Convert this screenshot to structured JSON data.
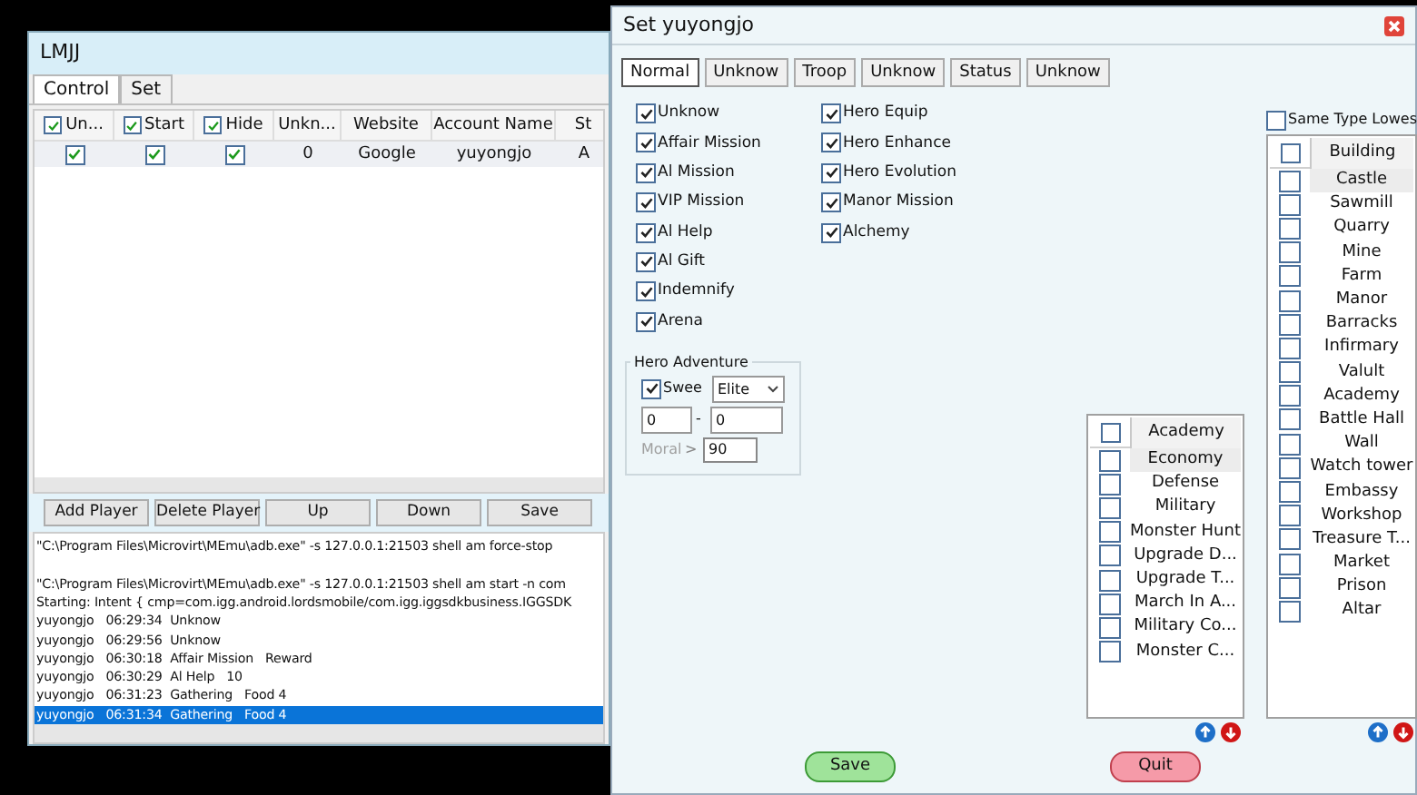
{
  "main_window": {
    "title": "LMJJ",
    "tabs": [
      {
        "label": "Control",
        "selected": true
      },
      {
        "label": "Set",
        "selected": false
      }
    ],
    "table": {
      "columns": [
        {
          "label": "Un...",
          "kind": "check",
          "checked": true
        },
        {
          "label": "Start",
          "kind": "check",
          "checked": true
        },
        {
          "label": "Hide",
          "kind": "check",
          "checked": true
        },
        {
          "label": "Unkn...",
          "kind": "plain"
        },
        {
          "label": "Website",
          "kind": "plain"
        },
        {
          "label": "Account Name",
          "kind": "plain"
        },
        {
          "label": "St",
          "kind": "plain"
        }
      ],
      "rows": [
        {
          "cells": [
            {
              "kind": "check",
              "checked": true
            },
            {
              "kind": "check",
              "checked": true
            },
            {
              "kind": "check",
              "checked": true
            },
            {
              "kind": "text",
              "text": "0"
            },
            {
              "kind": "text",
              "text": "Google"
            },
            {
              "kind": "text",
              "text": "yuyongjo"
            },
            {
              "kind": "text",
              "text": "A"
            }
          ]
        }
      ]
    },
    "buttons": [
      "Add Player",
      "Delete Player",
      "Up",
      "Down",
      "Save"
    ],
    "log": [
      {
        "text": "\"C:\\Program Files\\Microvirt\\MEmu\\adb.exe\" -s 127.0.0.1:21503 shell am force-stop",
        "selected": false
      },
      {
        "text": "\"C:\\Program Files\\Microvirt\\MEmu\\adb.exe\" -s 127.0.0.1:21503 shell am start -n com",
        "selected": false
      },
      {
        "text": "Starting: Intent { cmp=com.igg.android.lordsmobile/com.igg.iggsdkbusiness.IGGSDK",
        "selected": false
      },
      {
        "text": "yuyongjo   06:29:34  Unknow",
        "selected": false
      },
      {
        "text": "yuyongjo   06:29:56  Unknow",
        "selected": false
      },
      {
        "text": "yuyongjo   06:30:18  Affair Mission   Reward",
        "selected": false
      },
      {
        "text": "yuyongjo   06:30:29  Al Help   10",
        "selected": false
      },
      {
        "text": "yuyongjo   06:31:23  Gathering   Food 4",
        "selected": false
      },
      {
        "text": "yuyongjo   06:31:34  Gathering   Food 4",
        "selected": true
      }
    ]
  },
  "settings_window": {
    "title": "Set yuyongjo",
    "tabs": [
      {
        "label": "Normal",
        "selected": true
      },
      {
        "label": "Unknow",
        "selected": false
      },
      {
        "label": "Troop",
        "selected": false
      },
      {
        "label": "Unknow",
        "selected": false
      },
      {
        "label": "Status",
        "selected": false
      },
      {
        "label": "Unknow",
        "selected": false
      }
    ],
    "options_left": [
      {
        "label": "Unknow",
        "checked": true
      },
      {
        "label": "Affair Mission",
        "checked": true
      },
      {
        "label": "Al Mission",
        "checked": true
      },
      {
        "label": "VIP Mission",
        "checked": true
      },
      {
        "label": "Al Help",
        "checked": true
      },
      {
        "label": "Al Gift",
        "checked": true
      },
      {
        "label": "Indemnify",
        "checked": true
      },
      {
        "label": "Arena",
        "checked": true
      }
    ],
    "options_right": [
      {
        "label": "Hero Equip",
        "checked": true
      },
      {
        "label": "Hero Enhance",
        "checked": true
      },
      {
        "label": "Hero Evolution",
        "checked": true
      },
      {
        "label": "Manor Mission",
        "checked": true
      },
      {
        "label": "Alchemy",
        "checked": true
      }
    ],
    "hero_adventure": {
      "title": "Hero Adventure",
      "sweep": {
        "label": "Swee",
        "checked": true
      },
      "mode": "Elite",
      "range_from": "0",
      "separator": "-",
      "range_to": "0",
      "morale_label": "Moral",
      "morale_disabled": true,
      "comparator": ">",
      "morale_value": "90"
    },
    "same_type_lowest": {
      "label": "Same Type Lowes",
      "checked": false
    },
    "academy_list": {
      "header": "Academy",
      "header_checked": false,
      "rows": [
        {
          "label": "Economy",
          "checked": false,
          "selected": true
        },
        {
          "label": "Defense",
          "checked": false,
          "selected": false
        },
        {
          "label": "Military",
          "checked": false,
          "selected": false
        },
        {
          "label": "Monster Hunt",
          "checked": false,
          "selected": false
        },
        {
          "label": "Upgrade D...",
          "checked": false,
          "selected": false
        },
        {
          "label": "Upgrade T...",
          "checked": false,
          "selected": false
        },
        {
          "label": "March In A...",
          "checked": false,
          "selected": false
        },
        {
          "label": "Military Co...",
          "checked": false,
          "selected": false
        },
        {
          "label": "Monster C...",
          "checked": false,
          "selected": false
        }
      ]
    },
    "building_list": {
      "header": "Building",
      "header_checked": false,
      "rows": [
        {
          "label": "Castle",
          "checked": false,
          "selected": true
        },
        {
          "label": "Sawmill",
          "checked": false,
          "selected": false
        },
        {
          "label": "Quarry",
          "checked": false,
          "selected": false
        },
        {
          "label": "Mine",
          "checked": false,
          "selected": false
        },
        {
          "label": "Farm",
          "checked": false,
          "selected": false
        },
        {
          "label": "Manor",
          "checked": false,
          "selected": false
        },
        {
          "label": "Barracks",
          "checked": false,
          "selected": false
        },
        {
          "label": "Infirmary",
          "checked": false,
          "selected": false
        },
        {
          "label": "Valult",
          "checked": false,
          "selected": false
        },
        {
          "label": "Academy",
          "checked": false,
          "selected": false
        },
        {
          "label": "Battle Hall",
          "checked": false,
          "selected": false
        },
        {
          "label": "Wall",
          "checked": false,
          "selected": false
        },
        {
          "label": "Watch tower",
          "checked": false,
          "selected": false
        },
        {
          "label": "Embassy",
          "checked": false,
          "selected": false
        },
        {
          "label": "Workshop",
          "checked": false,
          "selected": false
        },
        {
          "label": "Treasure T...",
          "checked": false,
          "selected": false
        },
        {
          "label": "Market",
          "checked": false,
          "selected": false
        },
        {
          "label": "Prison",
          "checked": false,
          "selected": false
        },
        {
          "label": "Altar",
          "checked": false,
          "selected": false
        }
      ]
    },
    "buttons": [
      {
        "label": "Save",
        "kind": "save"
      },
      {
        "label": "Quit",
        "kind": "quit"
      }
    ]
  }
}
